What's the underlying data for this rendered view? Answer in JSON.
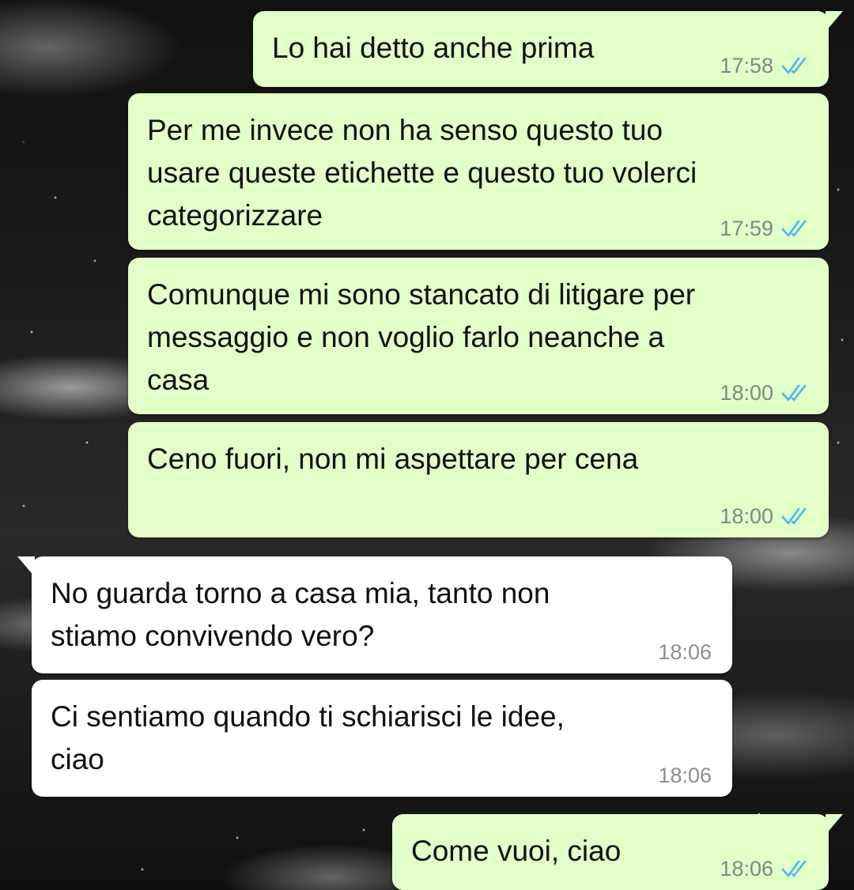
{
  "messages": [
    {
      "direction": "outgoing",
      "text": "Lo hai detto anche prima",
      "time": "17:58",
      "status_icon": "double-check-read-icon"
    },
    {
      "direction": "outgoing",
      "text": "Per me invece non ha senso questo tuo\nusare queste etichette e questo tuo volerci\ncategorizzare",
      "time": "17:59",
      "status_icon": "double-check-read-icon"
    },
    {
      "direction": "outgoing",
      "text": "Comunque mi sono stancato di litigare per\nmessaggio e non voglio farlo neanche a\ncasa",
      "time": "18:00",
      "status_icon": "double-check-read-icon"
    },
    {
      "direction": "outgoing",
      "text": "Ceno fuori, non mi aspettare per cena",
      "time": "18:00",
      "status_icon": "double-check-read-icon"
    },
    {
      "direction": "incoming",
      "text": "No guarda torno a casa mia, tanto non\nstiamo convivendo vero?",
      "time": "18:06"
    },
    {
      "direction": "incoming",
      "text": "Ci sentiamo quando ti schiarisci le idee,\nciao",
      "time": "18:06"
    },
    {
      "direction": "outgoing",
      "text": "Come vuoi, ciao",
      "time": "18:06",
      "status_icon": "double-check-read-icon"
    }
  ],
  "colors": {
    "outgoing_bubble": "#e2ffc8",
    "incoming_bubble": "#ffffff",
    "read_ticks": "#4fb6ec",
    "timestamp": "#7d8a87"
  }
}
